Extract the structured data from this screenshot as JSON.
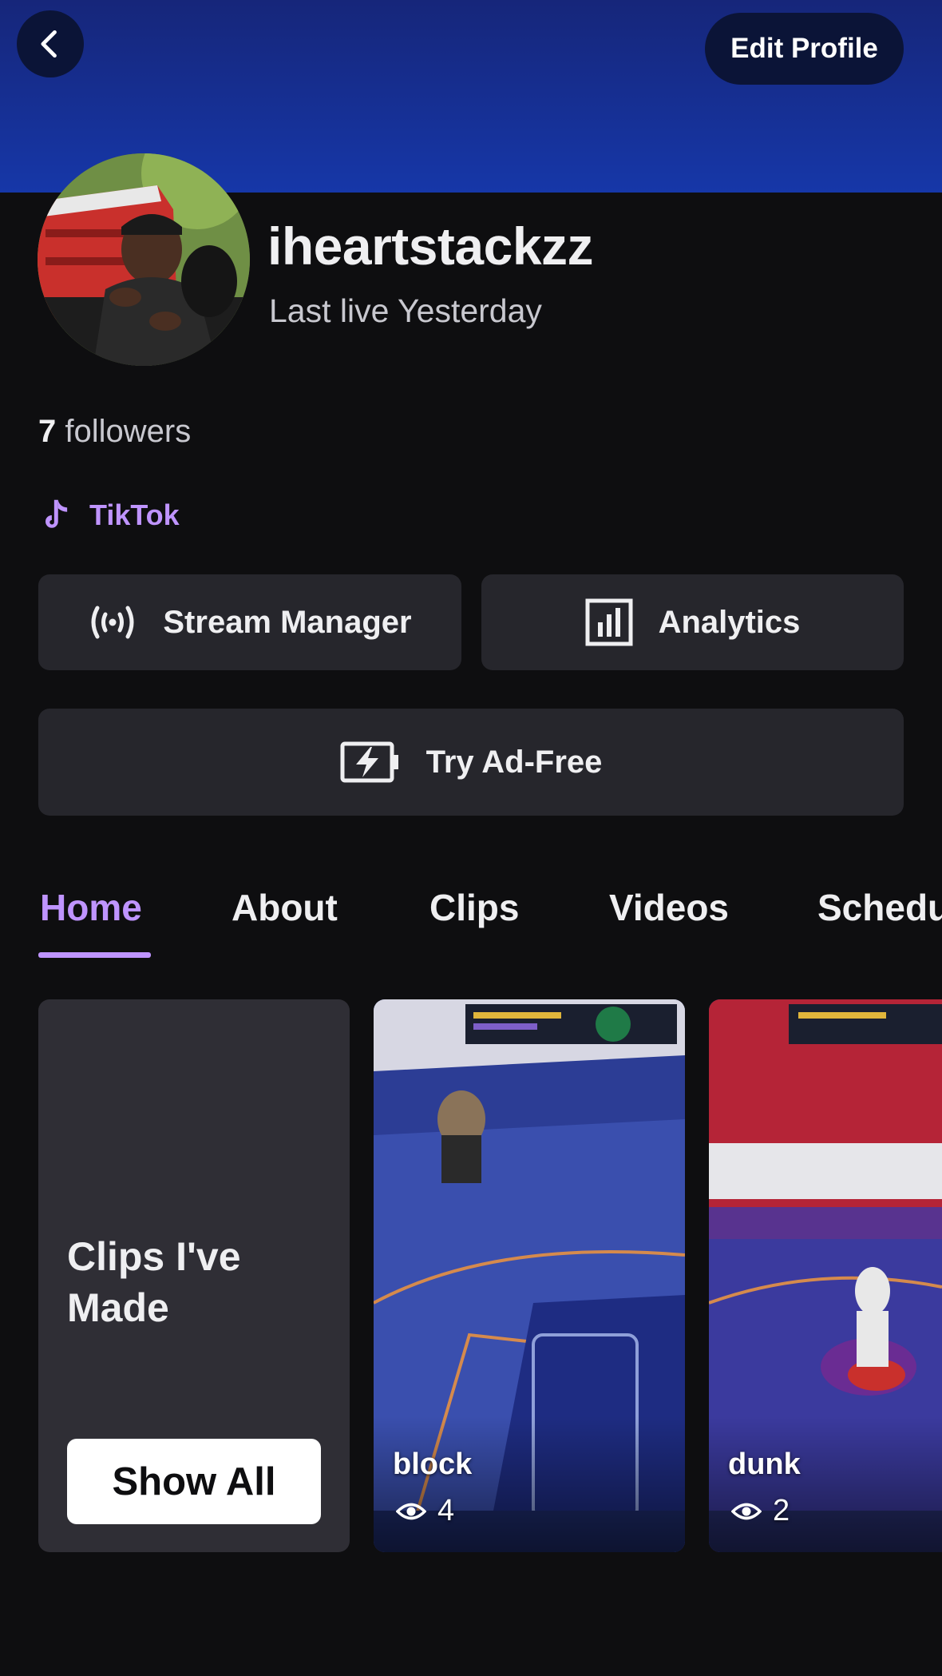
{
  "header": {
    "back_icon": "chevron-left-icon",
    "edit_profile_label": "Edit Profile"
  },
  "profile": {
    "username": "iheartstackzz",
    "last_live": "Last live Yesterday",
    "followers_count": "7",
    "followers_label": " followers",
    "social": {
      "icon": "tiktok-icon",
      "label": "TikTok"
    }
  },
  "actions": {
    "stream_manager": {
      "icon": "broadcast-icon",
      "label": "Stream Manager"
    },
    "analytics": {
      "icon": "bar-chart-icon",
      "label": "Analytics"
    },
    "ad_free": {
      "icon": "battery-bolt-icon",
      "label": "Try Ad-Free"
    }
  },
  "tabs": [
    {
      "label": "Home",
      "active": true
    },
    {
      "label": "About",
      "active": false
    },
    {
      "label": "Clips",
      "active": false
    },
    {
      "label": "Videos",
      "active": false
    },
    {
      "label": "Schedu",
      "active": false
    }
  ],
  "clips_section": {
    "title": "Clips I've Made",
    "show_all_label": "Show All",
    "clips": [
      {
        "title": "block",
        "views": "4",
        "view_icon": "eye-icon"
      },
      {
        "title": "dunk",
        "views": "2",
        "view_icon": "eye-icon"
      }
    ]
  },
  "colors": {
    "background": "#0e0e10",
    "banner_top": "#16267a",
    "banner_bottom": "#1637a8",
    "accent": "#bf94ff",
    "button_bg": "#26262c",
    "card_bg": "#2f2e35"
  }
}
